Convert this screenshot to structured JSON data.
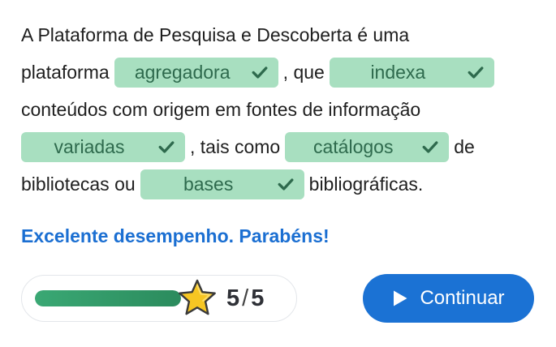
{
  "exercise": {
    "line1": "A Plataforma de Pesquisa e Descoberta é uma",
    "line2_pre": "plataforma",
    "blank1": "agregadora",
    "line2_mid": ", que",
    "blank2": "indexa",
    "line3": "conteúdos com origem em fontes de informação",
    "blank3": "variadas",
    "line4_mid": ", tais como",
    "blank4": "catálogos",
    "line4_post": "de",
    "line5_pre": "bibliotecas ou",
    "blank5": "bases",
    "line5_post": "bibliográficas.",
    "check_icon": "check-icon"
  },
  "feedback": "Excelente desempenho. Parabéns!",
  "progress": {
    "score": "5",
    "separator": "/",
    "total": "5",
    "fraction": 1.0,
    "star_icon": "star-icon"
  },
  "continue_button": {
    "label": "Continuar",
    "icon": "play-icon"
  },
  "colors": {
    "blank_bg": "#a8dfc0",
    "blank_text": "#2e6a4d",
    "feedback": "#1b6fd2",
    "button": "#1b72d4",
    "progress_fill": "#2b8b5d",
    "star": "#f6c623"
  }
}
